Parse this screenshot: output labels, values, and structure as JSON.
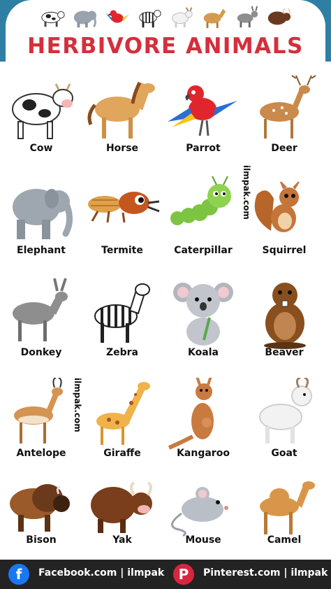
{
  "header": {
    "icons": [
      "cow-icon",
      "elephant-icon",
      "parrot-icon",
      "zebra-icon",
      "goat-icon",
      "horse-icon",
      "donkey-icon",
      "yak-icon"
    ],
    "title": "HERBIVORE ANIMALS"
  },
  "animals": [
    {
      "label": "Cow",
      "icon": "cow-icon"
    },
    {
      "label": "Horse",
      "icon": "horse-icon"
    },
    {
      "label": "Parrot",
      "icon": "parrot-icon"
    },
    {
      "label": "Deer",
      "icon": "deer-icon"
    },
    {
      "label": "Elephant",
      "icon": "elephant-icon"
    },
    {
      "label": "Termite",
      "icon": "termite-icon"
    },
    {
      "label": "Caterpillar",
      "icon": "caterpillar-icon"
    },
    {
      "label": "Squirrel",
      "icon": "squirrel-icon"
    },
    {
      "label": "Donkey",
      "icon": "donkey-icon"
    },
    {
      "label": "Zebra",
      "icon": "zebra-icon"
    },
    {
      "label": "Koala",
      "icon": "koala-icon"
    },
    {
      "label": "Beaver",
      "icon": "beaver-icon"
    },
    {
      "label": "Antelope",
      "icon": "antelope-icon"
    },
    {
      "label": "Giraffe",
      "icon": "giraffe-icon"
    },
    {
      "label": "Kangaroo",
      "icon": "kangaroo-icon"
    },
    {
      "label": "Goat",
      "icon": "goat-icon"
    },
    {
      "label": "Bison",
      "icon": "bison-icon"
    },
    {
      "label": "Yak",
      "icon": "yak-icon"
    },
    {
      "label": "Mouse",
      "icon": "mouse-icon"
    },
    {
      "label": "Camel",
      "icon": "camel-icon"
    }
  ],
  "watermarks": [
    "ilmpak.com",
    "ilmpak.com"
  ],
  "footer": {
    "facebook_text": "Facebook.com | ilmpak",
    "facebook_icon": "facebook-icon",
    "pinterest_text": "Pinterest.com | ilmpak",
    "pinterest_icon": "pinterest-icon"
  },
  "colors": {
    "title": "#d42f3c",
    "band": "#2f7fa4",
    "footer": "#232323",
    "facebook": "#1877f2",
    "pinterest": "#d7263d"
  }
}
